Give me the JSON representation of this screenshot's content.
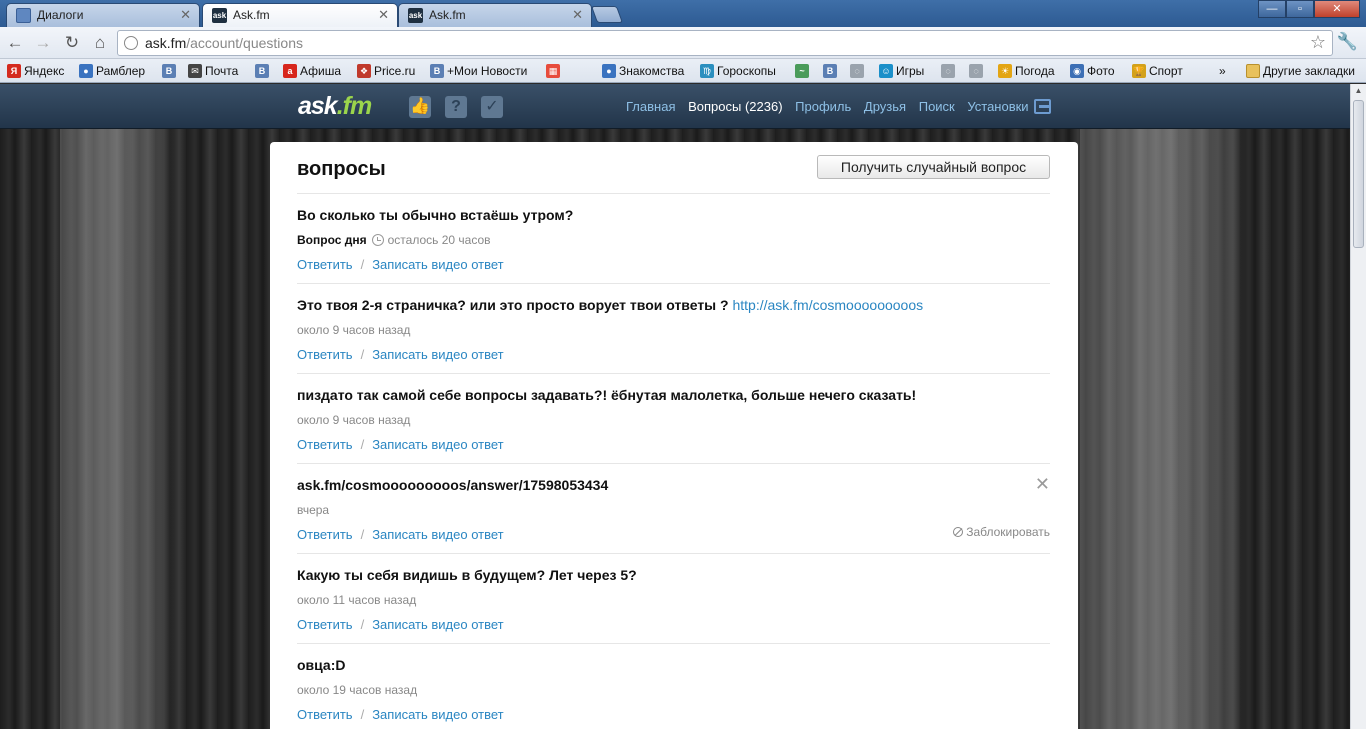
{
  "browser": {
    "tabs": [
      {
        "title": "Диалоги",
        "favicon": "message-icon"
      },
      {
        "title": "Ask.fm",
        "favicon": "ask-icon",
        "active": true
      },
      {
        "title": "Ask.fm",
        "favicon": "ask-icon"
      }
    ],
    "window_buttons": {
      "minimize": "—",
      "maximize": "▫",
      "close": "✕"
    },
    "url_host": "ask.fm",
    "url_path": "/account/questions",
    "bookmarks": [
      {
        "label": "Яндекс",
        "icon_text": "Я",
        "color": "#d42a1e"
      },
      {
        "label": "Рамблер",
        "icon_text": "●",
        "color": "#3a73c0"
      },
      {
        "label": "",
        "icon_text": "B",
        "color": "#5b7fb4"
      },
      {
        "label": "Почта",
        "icon_text": "✉",
        "color": "#444444"
      },
      {
        "label": "",
        "icon_text": "B",
        "color": "#5b7fb4"
      },
      {
        "label": "Афиша",
        "icon_text": "a",
        "color": "#d7261c"
      },
      {
        "label": "Price.ru",
        "icon_text": "❖",
        "color": "#c0392b"
      },
      {
        "label": "+Мои Новости",
        "icon_text": "B",
        "color": "#5b7fb4"
      },
      {
        "label": "",
        "icon_text": "▦",
        "color": "#e74c3c"
      },
      {
        "label": "Знакомства",
        "icon_text": "●",
        "color": "#3a73c0"
      },
      {
        "label": "Гороскопы",
        "icon_text": "♍",
        "color": "#2b8fbf"
      },
      {
        "label": "",
        "icon_text": "~",
        "color": "#4a9b5a"
      },
      {
        "label": "",
        "icon_text": "B",
        "color": "#5b7fb4"
      },
      {
        "label": "",
        "icon_text": "◌",
        "color": "#9aa3ad"
      },
      {
        "label": "Игры",
        "icon_text": "☺",
        "color": "#1a8fc9"
      },
      {
        "label": "",
        "icon_text": "◌",
        "color": "#9aa3ad"
      },
      {
        "label": "",
        "icon_text": "◌",
        "color": "#9aa3ad"
      },
      {
        "label": "Погода",
        "icon_text": "☀",
        "color": "#e3a514"
      },
      {
        "label": "Фото",
        "icon_text": "◉",
        "color": "#3c6fb5"
      },
      {
        "label": "Спорт",
        "icon_text": "🏆",
        "color": "#d3a11b"
      }
    ],
    "bookmarks_more": "»",
    "other_bookmarks": "Другие закладки"
  },
  "site": {
    "logo_main": "ask",
    "logo_tld": ".fm",
    "nav": [
      {
        "label": "Главная",
        "current": false
      },
      {
        "label": "Вопросы (2236)",
        "current": true
      },
      {
        "label": "Профиль",
        "current": false
      },
      {
        "label": "Друзья",
        "current": false
      },
      {
        "label": "Поиск",
        "current": false
      },
      {
        "label": "Установки",
        "current": false
      }
    ],
    "header_icons": [
      "like-icon",
      "question-icon",
      "answer-icon"
    ],
    "colors": {
      "header": "#2d4258",
      "link": "#2a86c2",
      "logo_accent": "#9bd54c"
    }
  },
  "main": {
    "title": "вопросы",
    "random_button": "Получить случайный вопрос",
    "questions": [
      {
        "text": "Во сколько ты обычно встаёшь утром?",
        "link": "",
        "meta_bold": "Вопрос дня",
        "meta": "осталось 20 часов",
        "clock": true,
        "answer": "Ответить",
        "video": "Записать видео ответ",
        "close": false,
        "block": ""
      },
      {
        "text": "Это твоя 2-я страничка? или это просто ворует твои ответы ?",
        "link": "http://ask.fm/cosmooooooooos",
        "meta_bold": "",
        "meta": "около 9 часов назад",
        "clock": false,
        "answer": "Ответить",
        "video": "Записать видео ответ",
        "close": false,
        "block": ""
      },
      {
        "text": "пиздато так самой себе вопросы задавать?! ёбнутая малолетка, больше нечего сказать!",
        "link": "",
        "meta_bold": "",
        "meta": "около 9 часов назад",
        "clock": false,
        "answer": "Ответить",
        "video": "Записать видео ответ",
        "close": false,
        "block": ""
      },
      {
        "text": "ask.fm/cosmooooooooos/answer/17598053434",
        "link": "",
        "meta_bold": "",
        "meta": "вчера",
        "clock": false,
        "answer": "Ответить",
        "video": "Записать видео ответ",
        "close": true,
        "block": "Заблокировать"
      },
      {
        "text": "Какую ты себя видишь в будущем? Лет через 5?",
        "link": "",
        "meta_bold": "",
        "meta": "около 11 часов назад",
        "clock": false,
        "answer": "Ответить",
        "video": "Записать видео ответ",
        "close": false,
        "block": ""
      },
      {
        "text": "овца:D",
        "link": "",
        "meta_bold": "",
        "meta": "около 19 часов назад",
        "clock": false,
        "answer": "Ответить",
        "video": "Записать видео ответ",
        "close": false,
        "block": ""
      }
    ]
  }
}
